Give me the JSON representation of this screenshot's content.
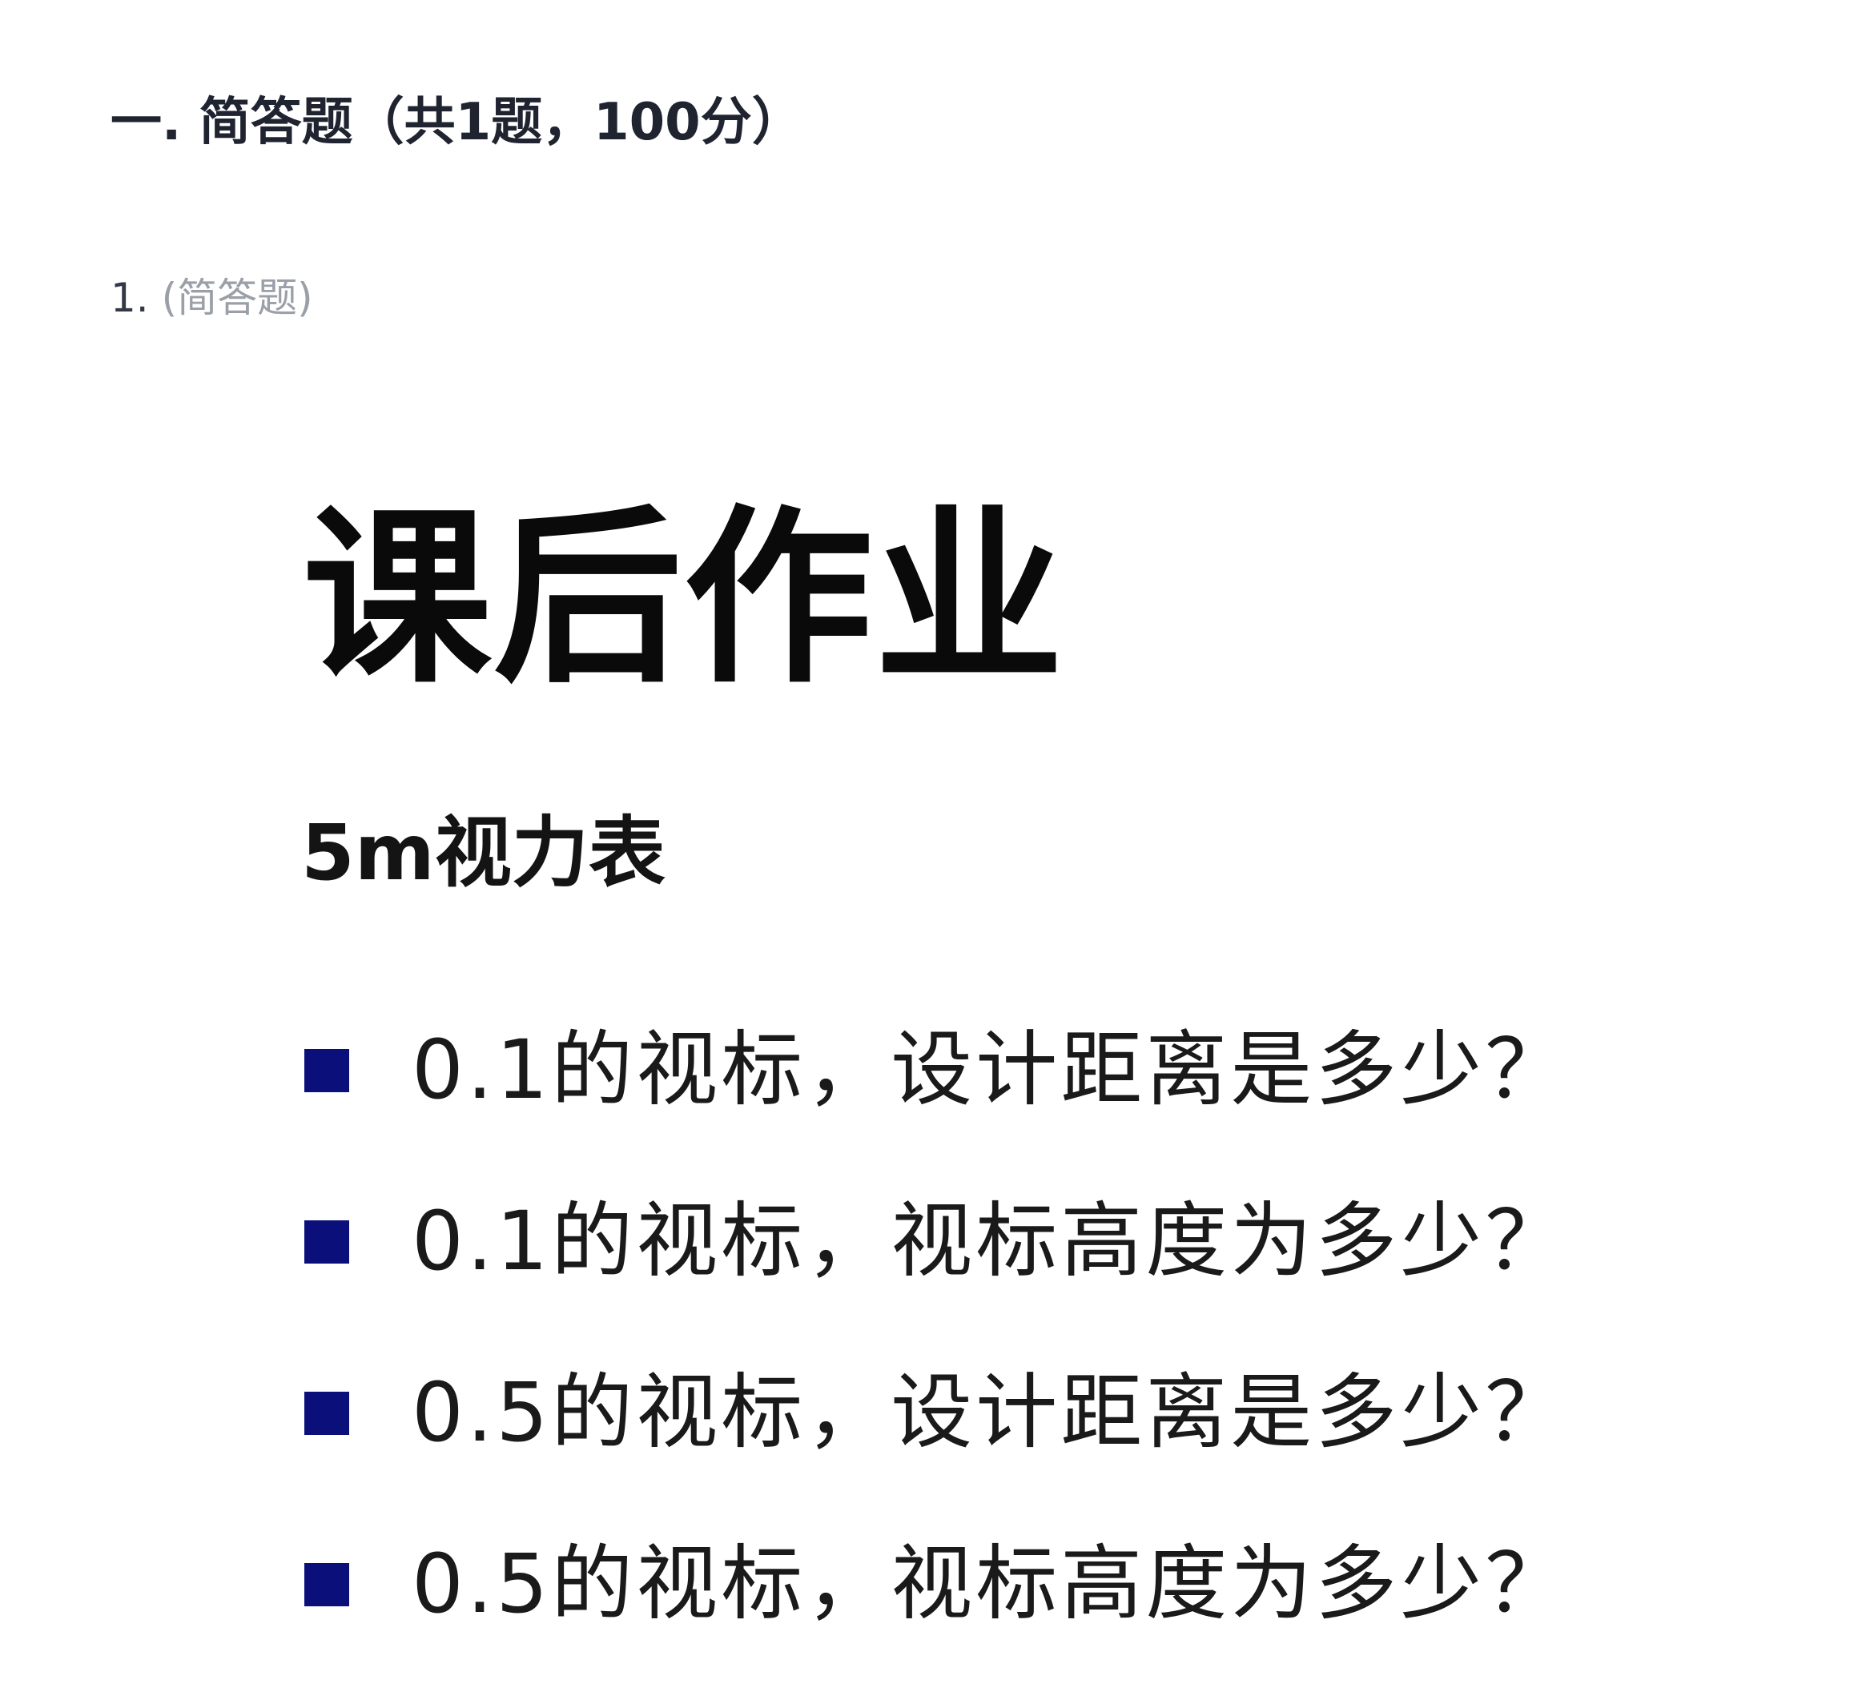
{
  "section": {
    "heading": "一. 简答题（共1题，100分）"
  },
  "question": {
    "number": "1.",
    "type_label": "(简答题)"
  },
  "question_image": {
    "title": "课后作业",
    "subtitle": "5m视力表",
    "bullet_color": "#0a0f7a",
    "items": [
      {
        "text": "0.1的视标，设计距离是多少？"
      },
      {
        "text": "0.1的视标，视标高度为多少？"
      },
      {
        "text": "0.5的视标，设计距离是多少？"
      },
      {
        "text": "0.5的视标，视标高度为多少？"
      }
    ]
  }
}
